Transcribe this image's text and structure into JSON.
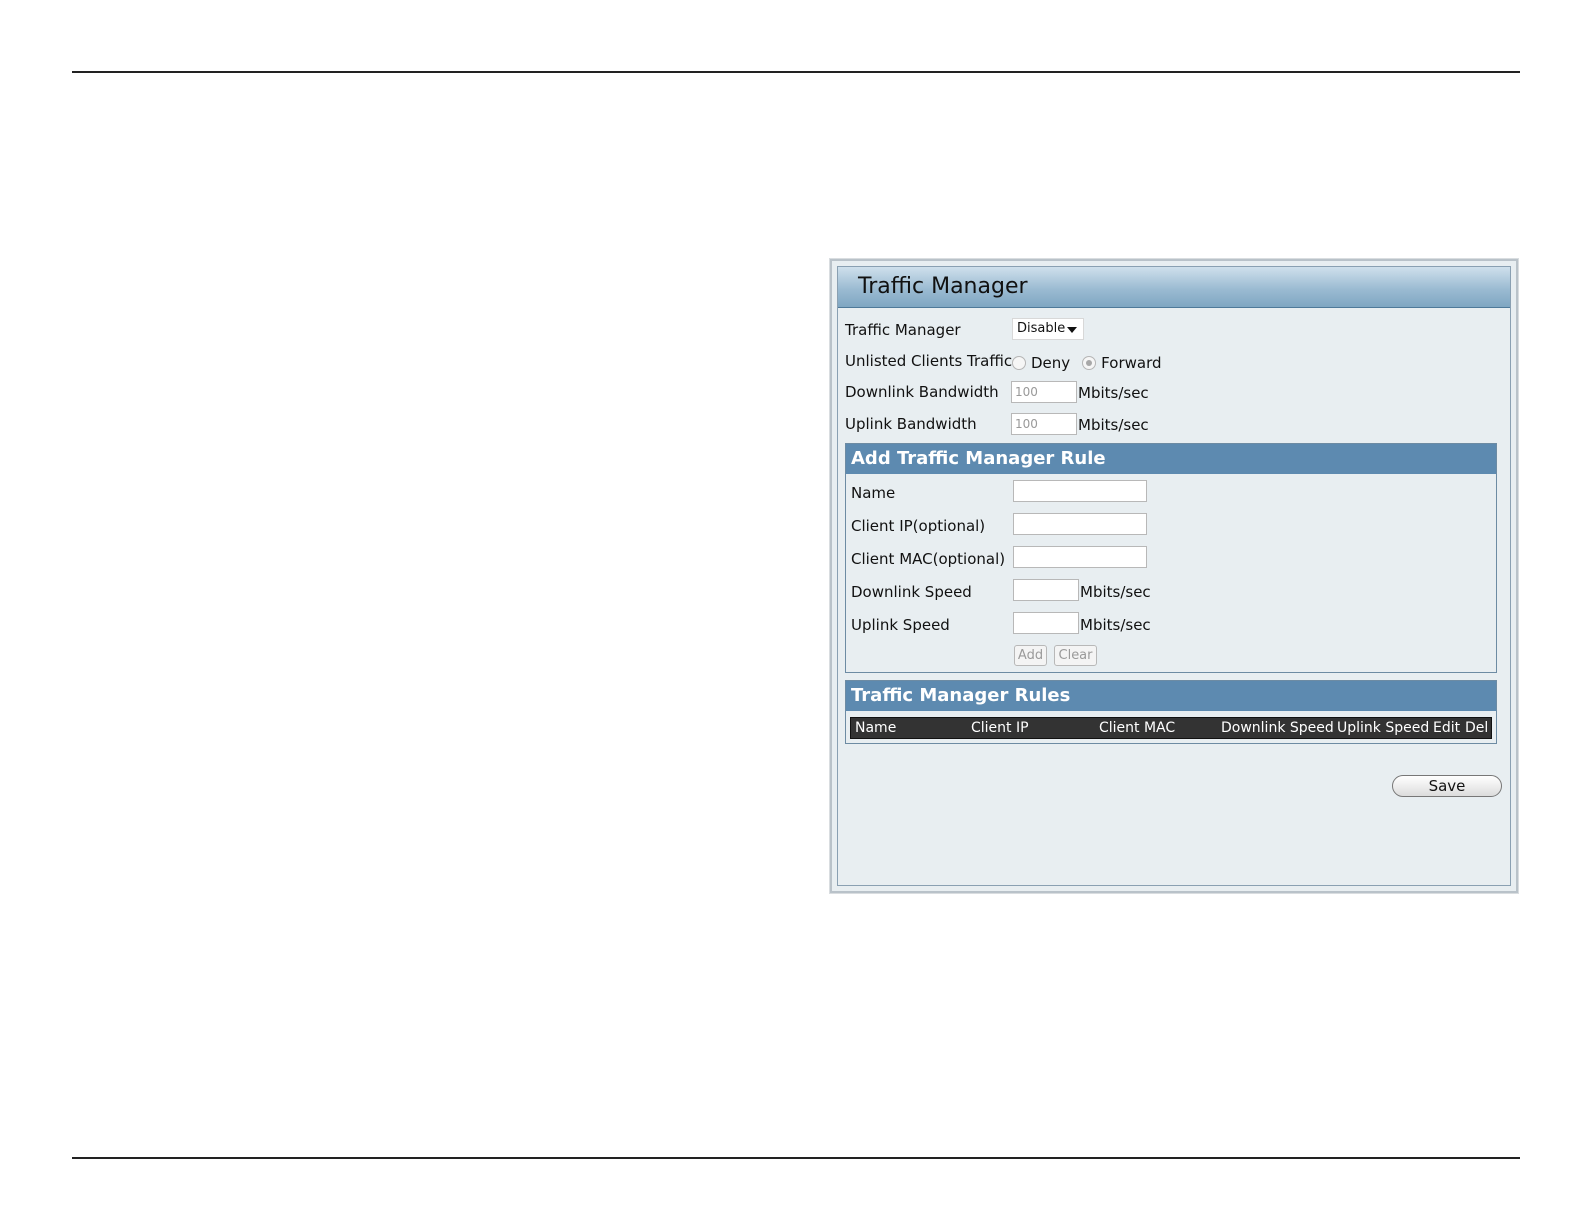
{
  "panel": {
    "title": "Traffic Manager"
  },
  "settings": {
    "traffic_manager": {
      "label": "Traffic Manager",
      "value": "Disable"
    },
    "unlisted_clients": {
      "label": "Unlisted Clients Traffic",
      "option_deny": "Deny",
      "option_forward": "Forward",
      "selected": "Forward"
    },
    "downlink_bandwidth": {
      "label": "Downlink Bandwidth",
      "value": "100",
      "unit": "Mbits/sec"
    },
    "uplink_bandwidth": {
      "label": "Uplink Bandwidth",
      "value": "100",
      "unit": "Mbits/sec"
    }
  },
  "add_rule": {
    "title": "Add Traffic Manager Rule",
    "name_label": "Name",
    "client_ip_label": "Client IP(optional)",
    "client_mac_label": "Client MAC(optional)",
    "downlink_speed_label": "Downlink Speed",
    "downlink_speed_unit": "Mbits/sec",
    "uplink_speed_label": "Uplink Speed",
    "uplink_speed_unit": "Mbits/sec",
    "add_button": "Add",
    "clear_button": "Clear"
  },
  "rules": {
    "title": "Traffic Manager Rules",
    "columns": [
      "Name",
      "Client IP",
      "Client MAC",
      "Downlink Speed",
      "Uplink Speed",
      "Edit",
      "Del"
    ]
  },
  "save_button": "Save"
}
